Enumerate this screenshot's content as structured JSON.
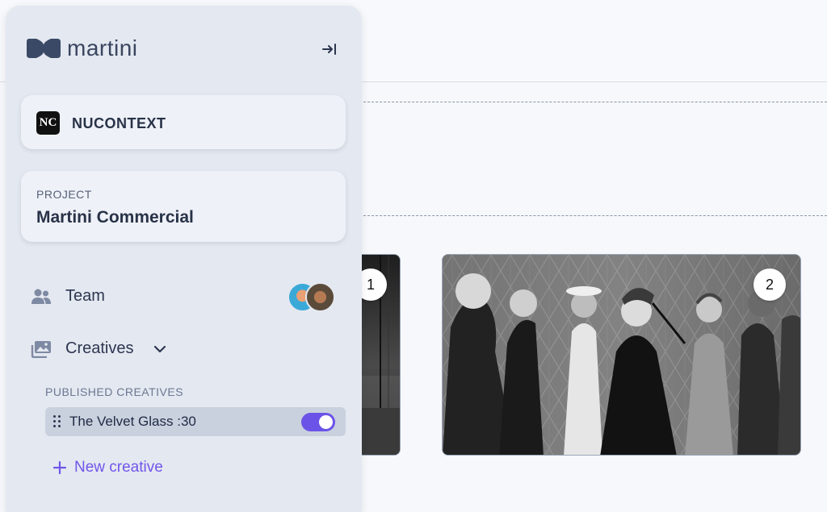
{
  "brand": {
    "name": "martini"
  },
  "organization": {
    "name": "NUCONTEXT",
    "logo_text": "NC"
  },
  "project": {
    "caption": "PROJECT",
    "name": "Martini Commercial"
  },
  "nav": {
    "team_label": "Team",
    "creatives_label": "Creatives"
  },
  "creatives": {
    "section_label": "PUBLISHED CREATIVES",
    "items": [
      {
        "name": "The Velvet Glass :30",
        "enabled": true
      }
    ],
    "new_label": "New creative"
  },
  "frames": [
    {
      "number": "1"
    },
    {
      "number": "2"
    }
  ],
  "colors": {
    "accent": "#6b53e8",
    "sidebar_bg": "#e4e8f0",
    "card_bg": "#eef1f7"
  },
  "icons": {
    "collapse": "arrow-right-to-line-icon",
    "team": "people-icon",
    "creatives": "images-icon",
    "chevron": "chevron-down-icon",
    "drag": "drag-handle-icon",
    "add": "plus-icon"
  }
}
